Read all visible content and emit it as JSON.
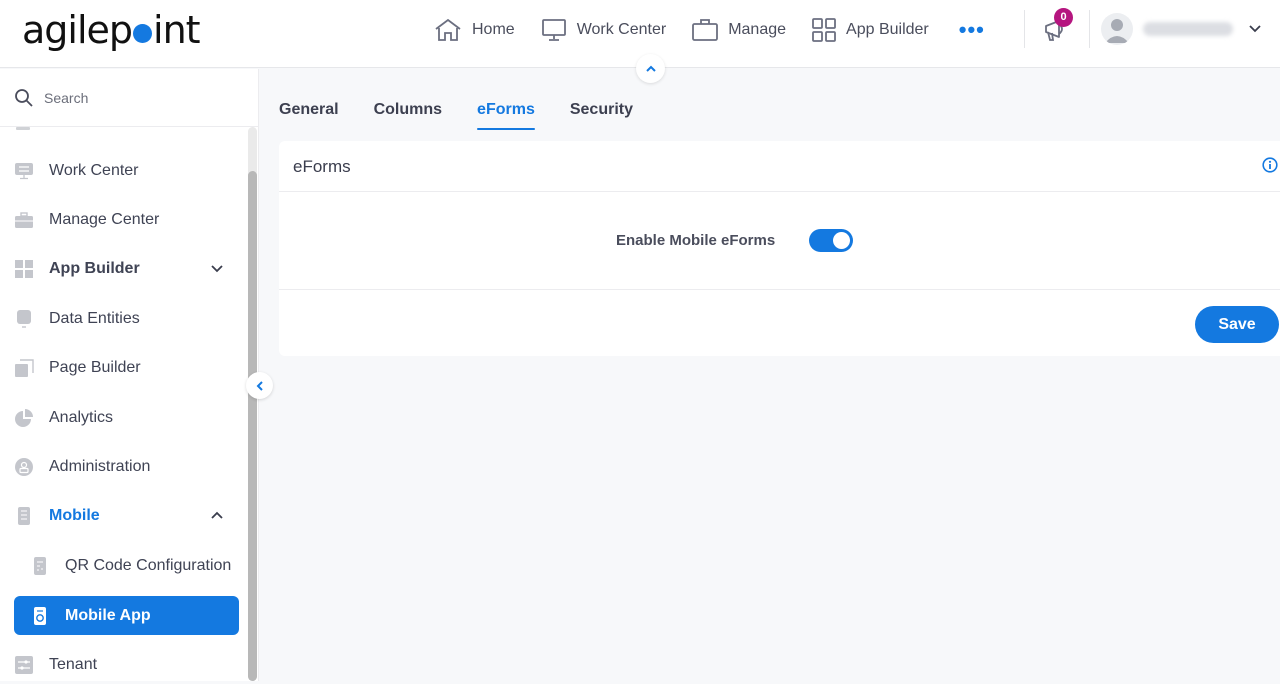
{
  "brand": {
    "logo_text_left": "agilep",
    "logo_text_right": "int",
    "accent": "#1479e0"
  },
  "topnav": {
    "items": [
      {
        "label": "Home",
        "icon": "home-icon"
      },
      {
        "label": "Work Center",
        "icon": "monitor-icon"
      },
      {
        "label": "Manage",
        "icon": "briefcase-icon"
      },
      {
        "label": "App Builder",
        "icon": "grid-icon"
      }
    ],
    "more_label": "•••",
    "notification_count": "0"
  },
  "sidebar": {
    "search_placeholder": "Search",
    "items": [
      {
        "label": "Work Center",
        "icon": "monitor-list-icon"
      },
      {
        "label": "Manage Center",
        "icon": "briefcase-icon"
      },
      {
        "label": "App Builder",
        "icon": "grid-icon",
        "expandable": true
      },
      {
        "label": "Data Entities",
        "icon": "database-icon"
      },
      {
        "label": "Page Builder",
        "icon": "pages-icon"
      },
      {
        "label": "Analytics",
        "icon": "pie-chart-icon"
      },
      {
        "label": "Administration",
        "icon": "admin-user-icon"
      },
      {
        "label": "Mobile",
        "icon": "mobile-icon",
        "expanded": true
      },
      {
        "label": "QR Code Configuration",
        "icon": "qr-code-icon"
      },
      {
        "label": "Mobile App",
        "icon": "mobile-app-icon",
        "active": true
      },
      {
        "label": "Tenant",
        "icon": "sliders-icon"
      }
    ]
  },
  "tabs": [
    {
      "label": "General"
    },
    {
      "label": "Columns"
    },
    {
      "label": "eForms",
      "active": true
    },
    {
      "label": "Security"
    }
  ],
  "card": {
    "title": "eForms",
    "field_label": "Enable Mobile eForms",
    "toggle_on": true,
    "save_label": "Save"
  }
}
